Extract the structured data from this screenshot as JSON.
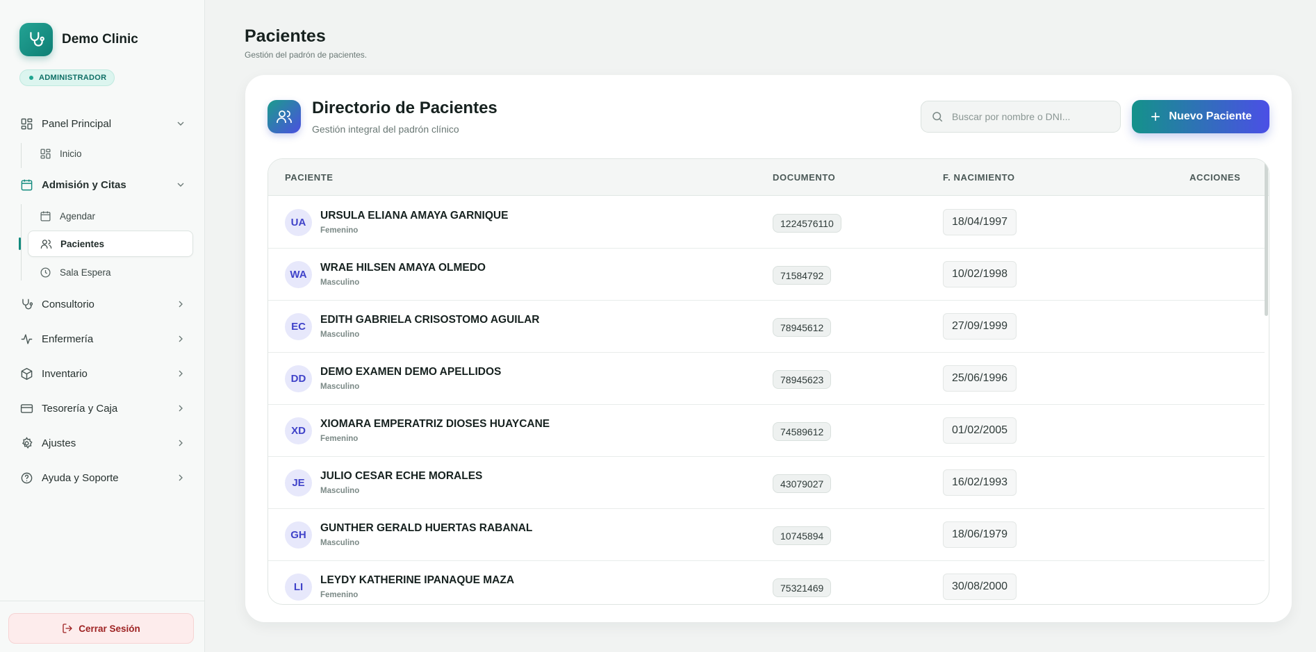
{
  "brand": {
    "name": "Demo Clinic",
    "role": "ADMINISTRADOR"
  },
  "nav": {
    "panel": "Panel Principal",
    "inicio": "Inicio",
    "admision": "Admisión y Citas",
    "agendar": "Agendar",
    "pacientes": "Pacientes",
    "sala": "Sala Espera",
    "consultorio": "Consultorio",
    "enfermeria": "Enfermería",
    "inventario": "Inventario",
    "tesoreria": "Tesorería y Caja",
    "ajustes": "Ajustes",
    "ayuda": "Ayuda y Soporte",
    "logout": "Cerrar Sesión"
  },
  "page": {
    "title": "Pacientes",
    "subtitle": "Gestión del padrón de pacientes."
  },
  "card": {
    "title": "Directorio de Pacientes",
    "subtitle": "Gestión integral del padrón clínico",
    "search_placeholder": "Buscar por nombre o DNI...",
    "new_button": "Nuevo Paciente"
  },
  "table": {
    "headers": {
      "patient": "PACIENTE",
      "document": "DOCUMENTO",
      "birth": "F. NACIMIENTO",
      "actions": "ACCIONES"
    },
    "rows": [
      {
        "initials": "UA",
        "name": "URSULA ELIANA AMAYA GARNIQUE",
        "gender": "Femenino",
        "doc": "1224576110",
        "dob": "18/04/1997"
      },
      {
        "initials": "WA",
        "name": "WRAE HILSEN AMAYA OLMEDO",
        "gender": "Masculino",
        "doc": "71584792",
        "dob": "10/02/1998"
      },
      {
        "initials": "EC",
        "name": "EDITH GABRIELA CRISOSTOMO AGUILAR",
        "gender": "Masculino",
        "doc": "78945612",
        "dob": "27/09/1999"
      },
      {
        "initials": "DD",
        "name": "DEMO EXAMEN DEMO APELLIDOS",
        "gender": "Masculino",
        "doc": "78945623",
        "dob": "25/06/1996"
      },
      {
        "initials": "XD",
        "name": "XIOMARA EMPERATRIZ DIOSES HUAYCANE",
        "gender": "Femenino",
        "doc": "74589612",
        "dob": "01/02/2005"
      },
      {
        "initials": "JE",
        "name": "JULIO CESAR ECHE MORALES",
        "gender": "Masculino",
        "doc": "43079027",
        "dob": "16/02/1993"
      },
      {
        "initials": "GH",
        "name": "GUNTHER GERALD HUERTAS RABANAL",
        "gender": "Masculino",
        "doc": "10745894",
        "dob": "18/06/1979"
      },
      {
        "initials": "LI",
        "name": "LEYDY KATHERINE IPANAQUE MAZA",
        "gender": "Femenino",
        "doc": "75321469",
        "dob": "30/08/2000"
      }
    ]
  }
}
